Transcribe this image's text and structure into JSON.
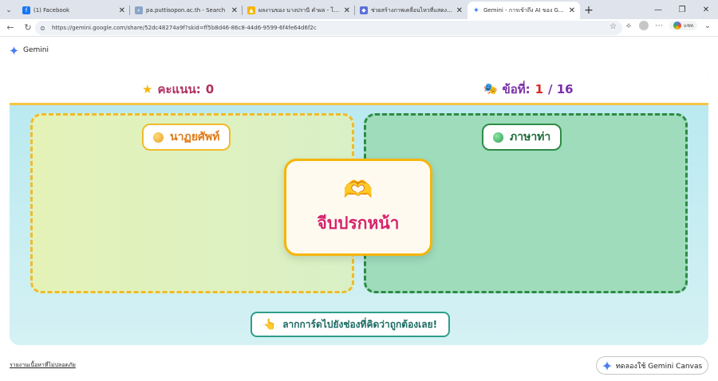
{
  "browser": {
    "tabs": [
      {
        "title": "(1) Facebook",
        "icon": "facebook-icon",
        "color": "#1877f2"
      },
      {
        "title": "pa.puttisopon.ac.th - Search",
        "icon": "search-icon",
        "color": "#8aa4c8"
      },
      {
        "title": "ผลงานของ นางปรานี คำผล - โรงเรียนภูฯ",
        "icon": "drive-icon",
        "color": "#f4b400"
      },
      {
        "title": "ช่วยสร้างภาพเคลื่อนไหวที่แสดงถึงความใจฯ",
        "icon": "gemini-chat-icon",
        "color": "#5b6fd6"
      },
      {
        "title": "Gemini - การเข้าถึง AI ของ Google ได้",
        "icon": "gemini-spark-icon",
        "color": "#4285f4",
        "active": true
      }
    ],
    "url": "https://gemini.google.com/share/52dc48274a9f?skid=ff5b8d46-86c8-44d6-9599-6f4fe64d6f2c",
    "profile_label": "แชท"
  },
  "gemini": {
    "brand": "Gemini"
  },
  "game": {
    "score_label": "คะแนน:",
    "score_value": "0",
    "question_label": "ข้อที่:",
    "question_current": "1",
    "question_total": "/ 16",
    "left_zone_label": "นาฏยศัพท์",
    "right_zone_label": "ภาษาท่า",
    "card_word": "จีบปรกหน้า",
    "hint_text": "ลากการ์ดไปยังช่องที่คิดว่าถูกต้องเลย!",
    "colors": {
      "accent_gold": "#f5b50a",
      "card_text": "#d6236d",
      "score_text": "#b03060",
      "question_text": "#7b2fa8"
    }
  },
  "footer": {
    "report_link": "รายงานเนื้อหาที่ไม่ปลอดภัย",
    "canvas_button": "ทดลองใช้ Gemini Canvas"
  }
}
